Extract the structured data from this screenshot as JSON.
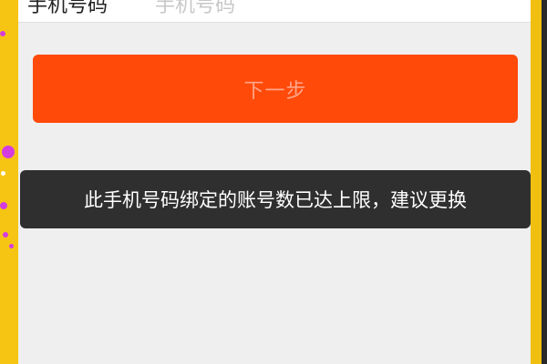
{
  "phone_field": {
    "label": "手机号码",
    "placeholder": "手机号码"
  },
  "next_button": {
    "label": "下一步"
  },
  "toast": {
    "message": "此手机号码绑定的账号数已达上限，建议更换"
  },
  "colors": {
    "primary_button": "#ff4a0a",
    "toast_bg": "#2f2f2f",
    "page_bg": "#efefef",
    "frame": "#f5c61a"
  }
}
